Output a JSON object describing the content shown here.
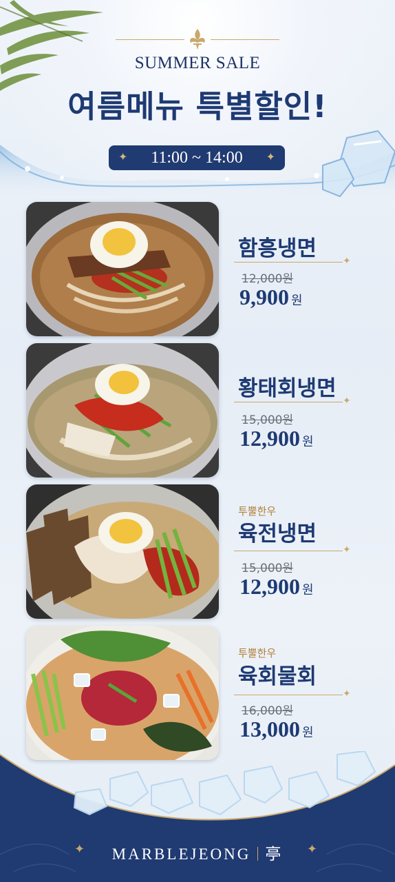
{
  "header": {
    "summer_label": "SUMMER SALE",
    "headline": "여름메뉴 특별할인!",
    "time_range": "11:00 ~ 14:00"
  },
  "items": [
    {
      "badge": "",
      "name": "함흥냉면",
      "old_price": "12,000원",
      "new_price": "9,900",
      "currency": "원"
    },
    {
      "badge": "",
      "name": "황태회냉면",
      "old_price": "15,000원",
      "new_price": "12,900",
      "currency": "원"
    },
    {
      "badge": "투뿔한우",
      "name": "육전냉면",
      "old_price": "15,000원",
      "new_price": "12,900",
      "currency": "원"
    },
    {
      "badge": "투뿔한우",
      "name": "육회물회",
      "old_price": "16,000원",
      "new_price": "13,000",
      "currency": "원"
    }
  ],
  "footer": {
    "brand": "MARBLEJEONG",
    "brand_char": "亭"
  },
  "colors": {
    "navy": "#1e3a73",
    "gold": "#c9a86a",
    "badge": "#b07f3a"
  }
}
